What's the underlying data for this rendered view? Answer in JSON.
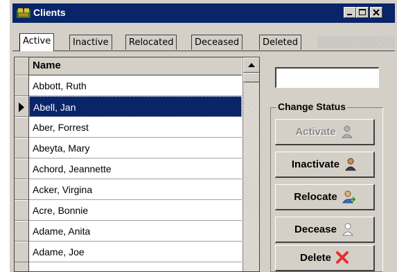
{
  "window": {
    "title": "Clients"
  },
  "tabs": [
    {
      "label": "Active",
      "active": true
    },
    {
      "label": "Inactive",
      "active": false
    },
    {
      "label": "Relocated",
      "active": false
    },
    {
      "label": "Deceased",
      "active": false
    },
    {
      "label": "Deleted",
      "active": false
    }
  ],
  "grid": {
    "column_header": "Name",
    "selected_index": 1,
    "rows": [
      "Abbott, Ruth",
      "Abell, Jan",
      "Aber, Forrest",
      "Abeyta, Mary",
      "Achord, Jeannette",
      "Acker, Virgina",
      "Acre, Bonnie",
      "Adame, Anita",
      "Adame, Joe"
    ]
  },
  "filter": {
    "value": ""
  },
  "change_status": {
    "legend": "Change Status",
    "buttons": [
      {
        "label": "Activate",
        "enabled": false,
        "icon": "person-gray-icon"
      },
      {
        "label": "Inactivate",
        "enabled": true,
        "icon": "person-dark-icon"
      },
      {
        "label": "Relocate",
        "enabled": true,
        "icon": "person-move-icon"
      },
      {
        "label": "Decease",
        "enabled": true,
        "icon": "person-outline-icon"
      },
      {
        "label": "Delete",
        "enabled": true,
        "icon": "red-x-icon"
      }
    ]
  },
  "colors": {
    "title_bar": "#0a246a",
    "selection": "#0a246a",
    "face": "#d4d0c8",
    "delete_icon": "#e53030"
  }
}
